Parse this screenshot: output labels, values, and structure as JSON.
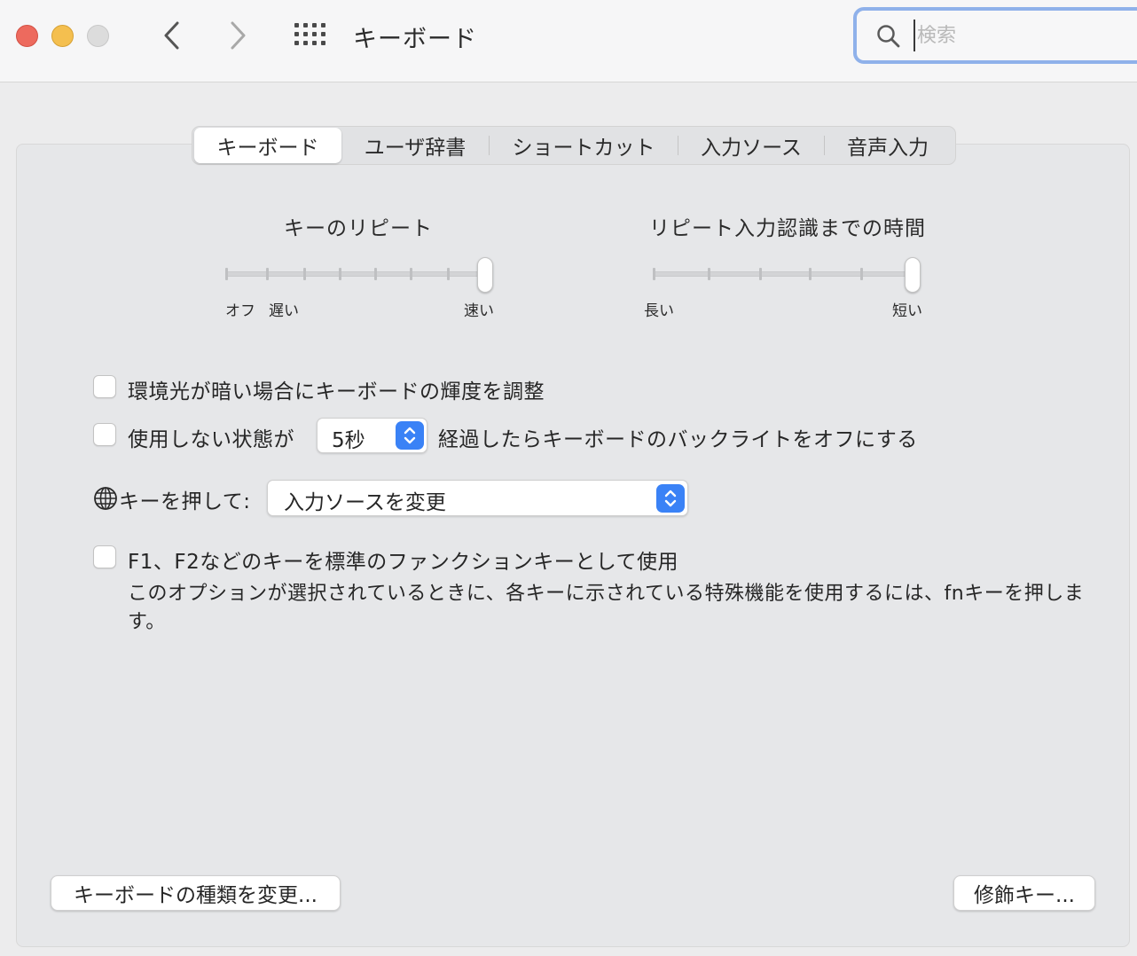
{
  "window": {
    "title": "キーボード",
    "search_placeholder": "検索"
  },
  "tabs": [
    {
      "label": "キーボード",
      "selected": true
    },
    {
      "label": "ユーザ辞書",
      "selected": false
    },
    {
      "label": "ショートカット",
      "selected": false
    },
    {
      "label": "入力ソース",
      "selected": false
    },
    {
      "label": "音声入力",
      "selected": false
    }
  ],
  "key_repeat": {
    "title": "キーのリピート",
    "label_off": "オフ",
    "label_slow": "遅い",
    "label_fast": "速い",
    "value_fraction": 1.0
  },
  "repeat_delay": {
    "title": "リピート入力認識までの時間",
    "label_long": "長い",
    "label_short": "短い",
    "value_fraction": 1.0
  },
  "options": {
    "ambient_label": "環境光が暗い場合にキーボードの輝度を調整",
    "ambient_checked": false,
    "backlight_prefix": "使用しない状態が",
    "backlight_value": "5秒",
    "backlight_suffix": "経過したらキーボードのバックライトをオフにする",
    "backlight_checked": false,
    "globe_label": "キーを押して:",
    "globe_value": "入力ソースを変更",
    "fn_label": "F1、F2などのキーを標準のファンクションキーとして使用",
    "fn_checked": false,
    "fn_description": "このオプションが選択されているときに、各キーに示されている特殊機能を使用するには、fnキーを押します。"
  },
  "buttons": {
    "change_keyboard_type": "キーボードの種類を変更...",
    "modifier_keys": "修飾キー..."
  },
  "colors": {
    "accent": "#3a82f6",
    "search_focus": "#8fb1ea",
    "close": "#ed6a5e",
    "minimize": "#f4bf4f"
  }
}
